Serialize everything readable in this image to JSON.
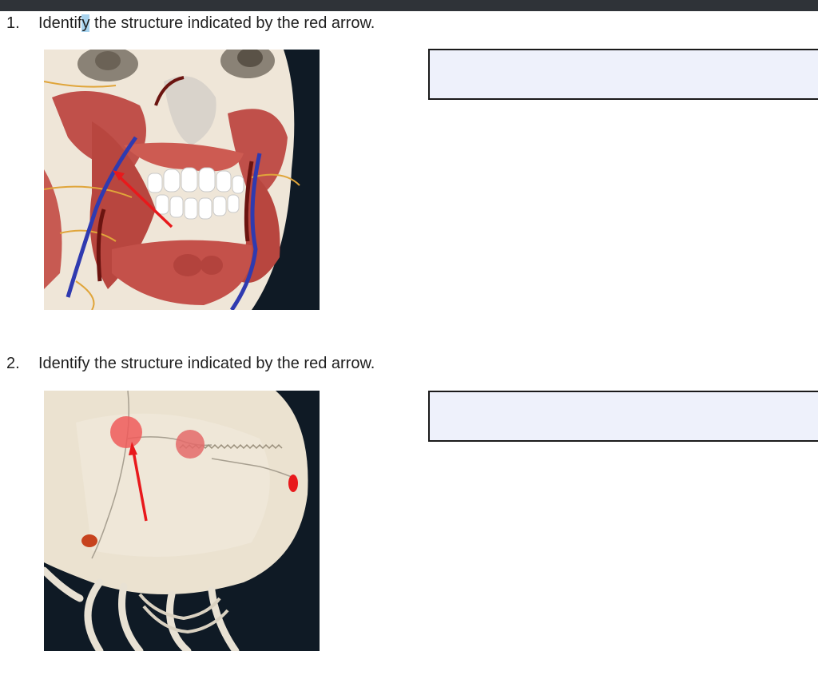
{
  "questions": [
    {
      "number": "1.",
      "text_before": "Identif",
      "text_highlight": "y",
      "text_after": " the structure indicated by the red arrow.",
      "figure_icon": "facial-muscles-anatomy-image",
      "answer": ""
    },
    {
      "number": "2.",
      "text_before": "Identify the structure indicated by the red arrow.",
      "text_highlight": "",
      "text_after": "",
      "figure_icon": "skull-sutures-anatomy-image",
      "answer": ""
    }
  ],
  "colors": {
    "top_bar": "#2f3338",
    "answer_box_fill": "#eef1fb",
    "answer_box_border": "#1a1a1a",
    "arrow": "#e8191c",
    "text_highlight": "#a9d4ef",
    "image_background": "#0f1a25"
  }
}
